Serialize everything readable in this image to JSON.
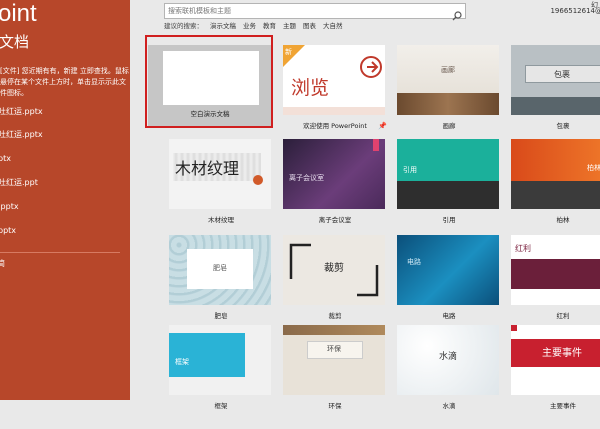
{
  "sidebar": {
    "title": "oint",
    "subtitle": "文档",
    "hint": "[文件] 您近期有有，新建 立即查找。鼠标悬停在某个文件上方时，单击显示示此文件图标。",
    "recent": [
      "吐红运.pptx",
      "吐红运.pptx",
      "ptx",
      "吐红运.ppt",
      ".pptx",
      "pptx"
    ],
    "more": "简"
  },
  "search": {
    "placeholder": "搜索联机模板和主题",
    "value": ""
  },
  "suggest": {
    "label": "建议的搜索：",
    "items": [
      "演示文稿",
      "业务",
      "教育",
      "主题",
      "图表",
      "大自然"
    ]
  },
  "user": {
    "top": "幻",
    "id": "1966512614@"
  },
  "templates": [
    {
      "label": "空白演示文稿",
      "text": ""
    },
    {
      "label": "欢迎使用 PowerPoint",
      "text": "浏览",
      "badge": "新"
    },
    {
      "label": "画廊",
      "text": "画廊"
    },
    {
      "label": "包裹",
      "text": "包裹"
    },
    {
      "label": "木材纹理",
      "text": "木材纹理"
    },
    {
      "label": "离子会议室",
      "text": "离子会议室"
    },
    {
      "label": "引用",
      "text": "引用"
    },
    {
      "label": "柏林",
      "text": "柏林"
    },
    {
      "label": "肥皂",
      "text": "肥皂"
    },
    {
      "label": "裁剪",
      "text": "裁剪"
    },
    {
      "label": "电路",
      "text": "电路"
    },
    {
      "label": "红利",
      "text": "红利"
    },
    {
      "label": "框架",
      "text": "框架"
    },
    {
      "label": "环保",
      "text": "环保"
    },
    {
      "label": "水滴",
      "text": "水滴"
    },
    {
      "label": "主要事件",
      "text": "主要事件"
    }
  ],
  "colors": {
    "accent": "#b7472a",
    "selection": "#d01f1f"
  }
}
